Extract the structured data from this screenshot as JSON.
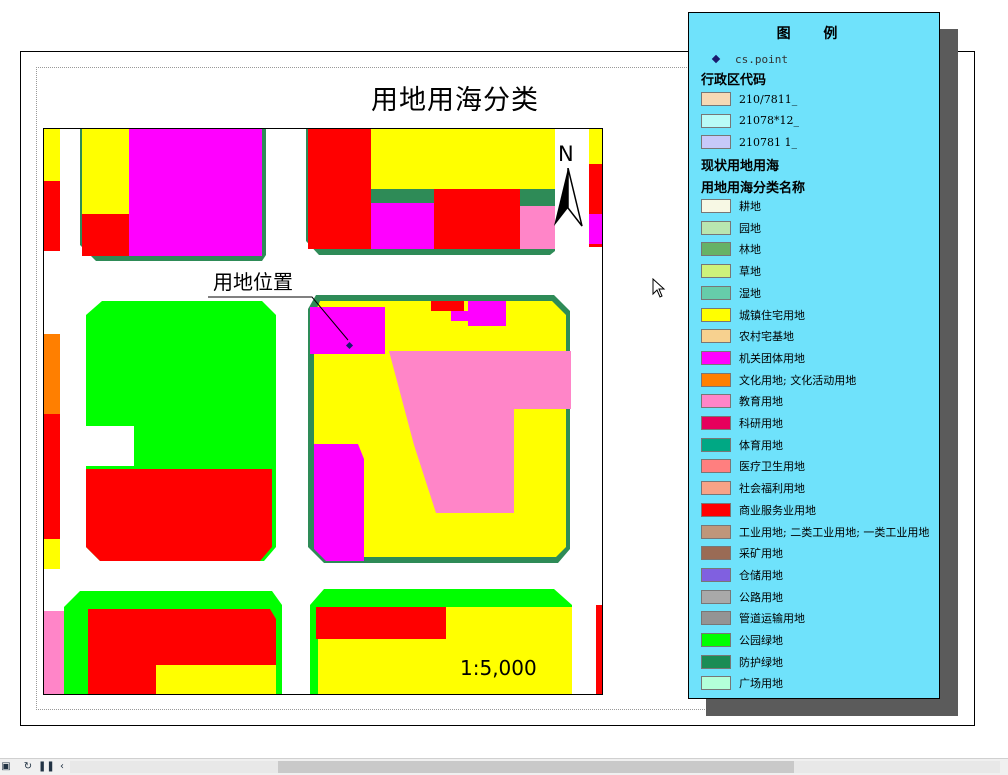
{
  "map": {
    "title": "用地用海分类",
    "scale": "1:5,000",
    "north_label": "N",
    "callout_label": "用地位置"
  },
  "legend": {
    "title": "图 例",
    "point_layer": "cs.point",
    "admin_heading": "行政区代码",
    "admin_items": [
      {
        "label": "210/7811_",
        "color": "#f7d9b5"
      },
      {
        "label": "21078*12_",
        "color": "#b9fbf7"
      },
      {
        "label": "210781 1_",
        "color": "#c7c9f9"
      }
    ],
    "current_heading": "现状用地用海",
    "class_heading": "用地用海分类名称",
    "classes": [
      {
        "label": "耕地",
        "color": "#f7f8e4"
      },
      {
        "label": "园地",
        "color": "#b9e6b0"
      },
      {
        "label": "林地",
        "color": "#66b266"
      },
      {
        "label": "草地",
        "color": "#cdf27a"
      },
      {
        "label": "湿地",
        "color": "#66cdaa"
      },
      {
        "label": "城镇住宅用地",
        "color": "#ffff00"
      },
      {
        "label": "农村宅基地",
        "color": "#f7d18f"
      },
      {
        "label": "机关团体用地",
        "color": "#ff00ff"
      },
      {
        "label": "文化用地; 文化活动用地",
        "color": "#ff7f00"
      },
      {
        "label": "教育用地",
        "color": "#ff85c8"
      },
      {
        "label": "科研用地",
        "color": "#e6005c"
      },
      {
        "label": "体育用地",
        "color": "#00a884"
      },
      {
        "label": "医疗卫生用地",
        "color": "#ff7f7f"
      },
      {
        "label": "社会福利用地",
        "color": "#f7a387"
      },
      {
        "label": "商业服务业用地",
        "color": "#ff0000"
      },
      {
        "label": "工业用地; 二类工业用地; 一类工业用地",
        "color": "#bf967a"
      },
      {
        "label": "采矿用地",
        "color": "#9a6b55"
      },
      {
        "label": "仓储用地",
        "color": "#8060e0"
      },
      {
        "label": "公路用地",
        "color": "#a9a9a9"
      },
      {
        "label": "管道运输用地",
        "color": "#949494"
      },
      {
        "label": "公园绿地",
        "color": "#00ff00"
      },
      {
        "label": "防护绿地",
        "color": "#1a8c55"
      },
      {
        "label": "广场用地",
        "color": "#b3ffd9"
      }
    ]
  },
  "colors": {
    "residential": "#ffff00",
    "institutional": "#ff00ff",
    "commercial": "#ff0000",
    "education": "#ff85c8",
    "park": "#00ff00",
    "protective": "#2e8b57",
    "culture": "#ff7f00",
    "legend_bg": "#6fe2fb"
  }
}
